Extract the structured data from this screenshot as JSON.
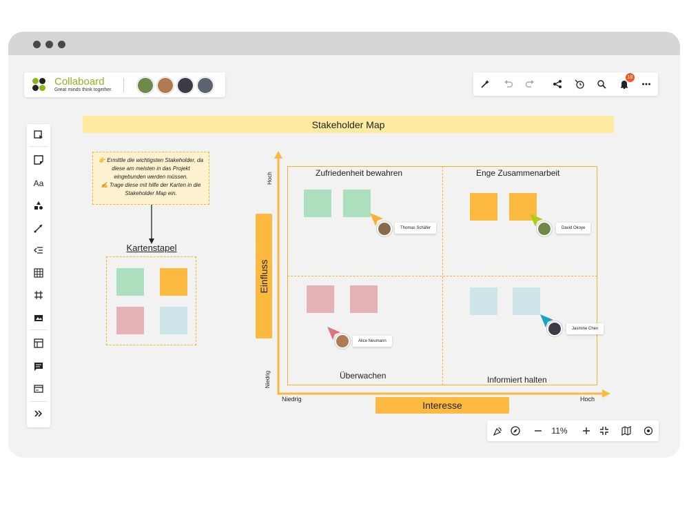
{
  "app": {
    "name": "Collaboard",
    "tagline": "Great minds think together.",
    "brand_color": "#8fb31b"
  },
  "collaborators": [
    {
      "icon": "avatar-man-green-shirt"
    },
    {
      "icon": "avatar-woman-curly-hair"
    },
    {
      "icon": "avatar-woman-dark-hair"
    },
    {
      "icon": "avatar-man-suit"
    }
  ],
  "toolbar": {
    "notifications_count": "16",
    "items": [
      "magic-wand-icon",
      "undo-icon",
      "redo-icon",
      "share-icon",
      "timer-icon",
      "search-icon",
      "bell-icon",
      "more-icon"
    ]
  },
  "tools": [
    "select-frame-icon",
    "sticky-note-icon",
    "text-icon",
    "shapes-icon",
    "connector-icon",
    "list-icon",
    "table-icon",
    "frame-icon",
    "media-icon",
    "template-icon",
    "comment-icon",
    "card-icon",
    "expand-icon"
  ],
  "zoom": {
    "value": "11%"
  },
  "board": {
    "title": "Stakeholder Map",
    "instructions_line1": "👉 Ermittle die wichtigsten Stakeholder, da diese am meisten in das Projekt eingebunden werden müssen.",
    "instructions_line2": "✍️ Trage diese mit hilfe der Karten in die Stakeholder Map ein.",
    "stack_title": "Kartenstapel",
    "quadrants": {
      "top_left": "Zufriedenheit bewahren",
      "top_right": "Enge Zusammenarbeit",
      "bottom_left": "Überwachen",
      "bottom_right": "Informiert halten"
    },
    "y_axis": {
      "label": "Einfluss",
      "low": "Niedrig",
      "high": "Hoch"
    },
    "x_axis": {
      "label": "Interesse",
      "low": "Niedrig",
      "high": "Hoch"
    },
    "cursors": [
      {
        "name": "Thomas Schäfer",
        "color": "#f5b335"
      },
      {
        "name": "David Okoye",
        "color": "#b4c81c"
      },
      {
        "name": "Alice Neumann",
        "color": "#e0747a"
      },
      {
        "name": "Jasmine Chen",
        "color": "#1aa3c6"
      }
    ],
    "colors": {
      "accent": "#fbba3f",
      "green": "#acdfbd",
      "orange": "#fbba3f",
      "pink": "#e5b2b8",
      "blue": "#cde5e9"
    }
  }
}
